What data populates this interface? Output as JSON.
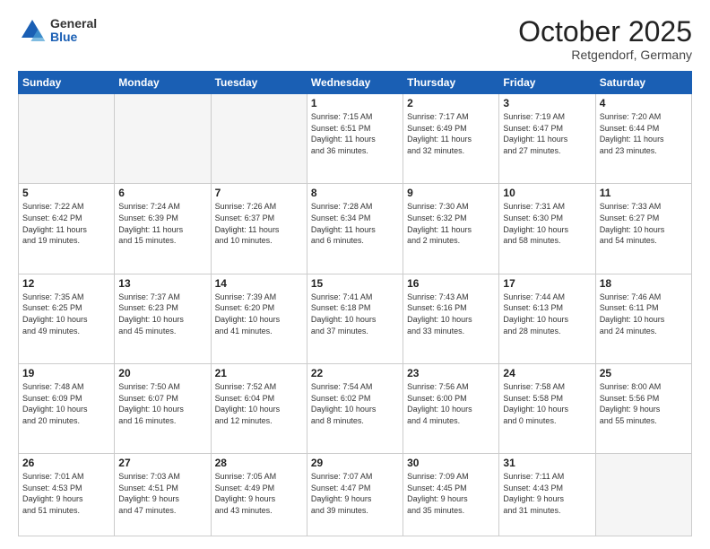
{
  "header": {
    "logo_general": "General",
    "logo_blue": "Blue",
    "month": "October 2025",
    "location": "Retgendorf, Germany"
  },
  "days_of_week": [
    "Sunday",
    "Monday",
    "Tuesday",
    "Wednesday",
    "Thursday",
    "Friday",
    "Saturday"
  ],
  "weeks": [
    [
      {
        "day": "",
        "info": ""
      },
      {
        "day": "",
        "info": ""
      },
      {
        "day": "",
        "info": ""
      },
      {
        "day": "1",
        "info": "Sunrise: 7:15 AM\nSunset: 6:51 PM\nDaylight: 11 hours\nand 36 minutes."
      },
      {
        "day": "2",
        "info": "Sunrise: 7:17 AM\nSunset: 6:49 PM\nDaylight: 11 hours\nand 32 minutes."
      },
      {
        "day": "3",
        "info": "Sunrise: 7:19 AM\nSunset: 6:47 PM\nDaylight: 11 hours\nand 27 minutes."
      },
      {
        "day": "4",
        "info": "Sunrise: 7:20 AM\nSunset: 6:44 PM\nDaylight: 11 hours\nand 23 minutes."
      }
    ],
    [
      {
        "day": "5",
        "info": "Sunrise: 7:22 AM\nSunset: 6:42 PM\nDaylight: 11 hours\nand 19 minutes."
      },
      {
        "day": "6",
        "info": "Sunrise: 7:24 AM\nSunset: 6:39 PM\nDaylight: 11 hours\nand 15 minutes."
      },
      {
        "day": "7",
        "info": "Sunrise: 7:26 AM\nSunset: 6:37 PM\nDaylight: 11 hours\nand 10 minutes."
      },
      {
        "day": "8",
        "info": "Sunrise: 7:28 AM\nSunset: 6:34 PM\nDaylight: 11 hours\nand 6 minutes."
      },
      {
        "day": "9",
        "info": "Sunrise: 7:30 AM\nSunset: 6:32 PM\nDaylight: 11 hours\nand 2 minutes."
      },
      {
        "day": "10",
        "info": "Sunrise: 7:31 AM\nSunset: 6:30 PM\nDaylight: 10 hours\nand 58 minutes."
      },
      {
        "day": "11",
        "info": "Sunrise: 7:33 AM\nSunset: 6:27 PM\nDaylight: 10 hours\nand 54 minutes."
      }
    ],
    [
      {
        "day": "12",
        "info": "Sunrise: 7:35 AM\nSunset: 6:25 PM\nDaylight: 10 hours\nand 49 minutes."
      },
      {
        "day": "13",
        "info": "Sunrise: 7:37 AM\nSunset: 6:23 PM\nDaylight: 10 hours\nand 45 minutes."
      },
      {
        "day": "14",
        "info": "Sunrise: 7:39 AM\nSunset: 6:20 PM\nDaylight: 10 hours\nand 41 minutes."
      },
      {
        "day": "15",
        "info": "Sunrise: 7:41 AM\nSunset: 6:18 PM\nDaylight: 10 hours\nand 37 minutes."
      },
      {
        "day": "16",
        "info": "Sunrise: 7:43 AM\nSunset: 6:16 PM\nDaylight: 10 hours\nand 33 minutes."
      },
      {
        "day": "17",
        "info": "Sunrise: 7:44 AM\nSunset: 6:13 PM\nDaylight: 10 hours\nand 28 minutes."
      },
      {
        "day": "18",
        "info": "Sunrise: 7:46 AM\nSunset: 6:11 PM\nDaylight: 10 hours\nand 24 minutes."
      }
    ],
    [
      {
        "day": "19",
        "info": "Sunrise: 7:48 AM\nSunset: 6:09 PM\nDaylight: 10 hours\nand 20 minutes."
      },
      {
        "day": "20",
        "info": "Sunrise: 7:50 AM\nSunset: 6:07 PM\nDaylight: 10 hours\nand 16 minutes."
      },
      {
        "day": "21",
        "info": "Sunrise: 7:52 AM\nSunset: 6:04 PM\nDaylight: 10 hours\nand 12 minutes."
      },
      {
        "day": "22",
        "info": "Sunrise: 7:54 AM\nSunset: 6:02 PM\nDaylight: 10 hours\nand 8 minutes."
      },
      {
        "day": "23",
        "info": "Sunrise: 7:56 AM\nSunset: 6:00 PM\nDaylight: 10 hours\nand 4 minutes."
      },
      {
        "day": "24",
        "info": "Sunrise: 7:58 AM\nSunset: 5:58 PM\nDaylight: 10 hours\nand 0 minutes."
      },
      {
        "day": "25",
        "info": "Sunrise: 8:00 AM\nSunset: 5:56 PM\nDaylight: 9 hours\nand 55 minutes."
      }
    ],
    [
      {
        "day": "26",
        "info": "Sunrise: 7:01 AM\nSunset: 4:53 PM\nDaylight: 9 hours\nand 51 minutes."
      },
      {
        "day": "27",
        "info": "Sunrise: 7:03 AM\nSunset: 4:51 PM\nDaylight: 9 hours\nand 47 minutes."
      },
      {
        "day": "28",
        "info": "Sunrise: 7:05 AM\nSunset: 4:49 PM\nDaylight: 9 hours\nand 43 minutes."
      },
      {
        "day": "29",
        "info": "Sunrise: 7:07 AM\nSunset: 4:47 PM\nDaylight: 9 hours\nand 39 minutes."
      },
      {
        "day": "30",
        "info": "Sunrise: 7:09 AM\nSunset: 4:45 PM\nDaylight: 9 hours\nand 35 minutes."
      },
      {
        "day": "31",
        "info": "Sunrise: 7:11 AM\nSunset: 4:43 PM\nDaylight: 9 hours\nand 31 minutes."
      },
      {
        "day": "",
        "info": ""
      }
    ]
  ]
}
